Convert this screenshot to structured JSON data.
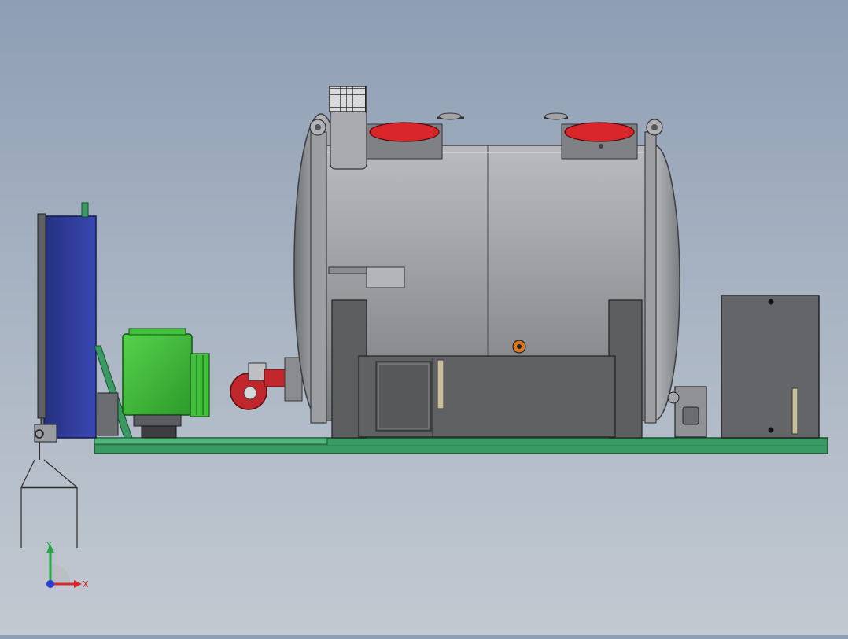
{
  "viewport": {
    "background_top": "#8e9eb4",
    "background_bottom": "#c3c9d1"
  },
  "model": {
    "colors": {
      "tank_body": "#8f9194",
      "tank_highlight": "#c3c4c6",
      "base_frame": "#3a9a63",
      "pump_unit": "#3fbf3a",
      "panel": "#2f3a9a",
      "burner": "#c0262b",
      "manhole_cover": "#d9262a",
      "housing": "#5c5e60"
    }
  },
  "triad": {
    "x_label": "X",
    "y_label": "Y",
    "x_color": "#d42a2a",
    "y_color": "#22a845",
    "z_color": "#2a3fd4"
  }
}
